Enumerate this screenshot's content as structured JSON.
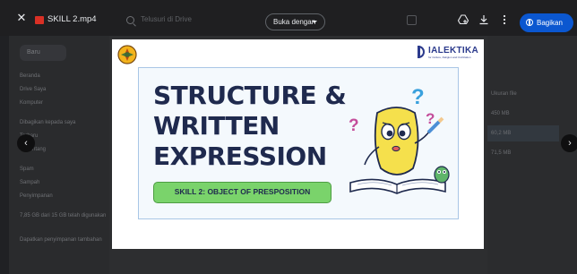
{
  "topbar": {
    "file_name": "SKILL 2.mp4",
    "search_placeholder": "Telusuri di Drive",
    "open_with_label": "Buka dengan",
    "share_label": "Bagikan"
  },
  "background": {
    "new_label": "Baru",
    "sidebar_items": [
      "Beranda",
      "Drive Saya",
      "Komputer",
      "Dibagikan kepada saya",
      "Terbaru",
      "Berbintang",
      "Spam",
      "Sampah",
      "Penyimpanan",
      "7,85 GB dari 15 GB telah digunakan",
      "Dapatkan penyimpanan tambahan"
    ],
    "right_items": [
      "Ukuran file",
      "450 MB",
      "60,2 MB",
      "71,5 MB"
    ]
  },
  "slide": {
    "title_lines": [
      "STRUCTURE &",
      "WRITTEN",
      "EXPRESSION"
    ],
    "subtitle": "SKILL 2: OBJECT OF PRESPOSITION",
    "brand_name": "IALEKTIKA",
    "brand_tagline": "for Culture, Religion and Civilization",
    "accent_green": "#7ad36b",
    "navy": "#1f2a4e"
  },
  "icons": [
    "close-icon",
    "video-file-icon",
    "search-icon",
    "add-to-drive-icon",
    "download-icon",
    "more-vert-icon",
    "globe-icon",
    "chevron-left-icon",
    "chevron-right-icon"
  ]
}
